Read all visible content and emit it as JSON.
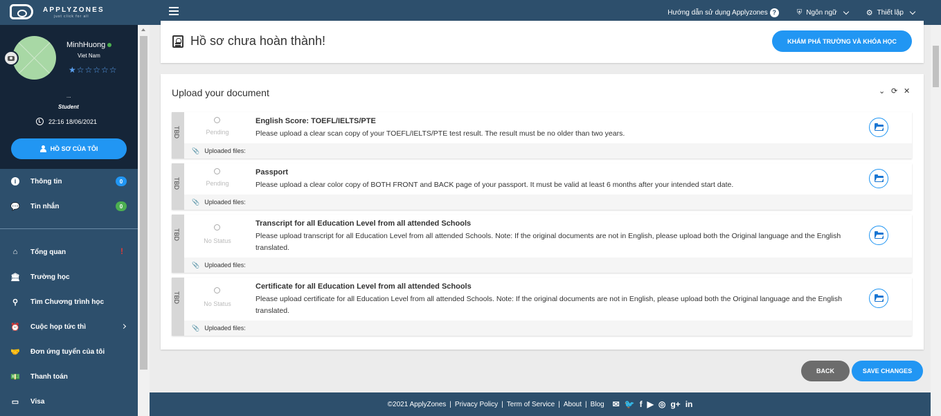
{
  "header": {
    "logo_text": "APPLYZONES",
    "logo_tagline": "just click for all",
    "help_label": "Hướng dẫn sử dụng Applyzones",
    "help_icon": "?",
    "language_label": "Ngôn ngữ",
    "settings_label": "Thiết lập"
  },
  "profile": {
    "name": "MinhHuong",
    "country": "Viet Nam",
    "rating": "★☆☆☆☆☆",
    "placeholder": "...",
    "role": "Student",
    "datetime": "22:16 18/06/2021",
    "button_label": "HỒ SƠ CỦA TÔI"
  },
  "sidebar": {
    "top_items": [
      {
        "label": "Thông tin",
        "badge": "0",
        "badge_color": "#2196f3"
      },
      {
        "label": "Tin nhắn",
        "badge": "0",
        "badge_color": "#4caf50"
      }
    ],
    "items": [
      {
        "label": "Tổng quan",
        "icon": "home-icon",
        "alert": "!"
      },
      {
        "label": "Trường học",
        "icon": "school-icon"
      },
      {
        "label": "Tìm Chương trình học",
        "icon": "search-icon"
      },
      {
        "label": "Cuộc họp tức thì",
        "icon": "meeting-icon"
      },
      {
        "label": "Đơn ứng tuyển của tôi",
        "icon": "handshake-icon"
      },
      {
        "label": "Thanh toán",
        "icon": "money-icon"
      },
      {
        "label": "Visa",
        "icon": "card-icon"
      }
    ]
  },
  "main": {
    "incomplete_title": "Hồ sơ chưa hoàn thành!",
    "explore_button": "KHÁM PHÁ TRƯỜNG VÀ KHÓA HỌC",
    "upload_title": "Upload your document",
    "documents": [
      {
        "tag": "TBD",
        "status": "Pending",
        "title": "English Score: TOEFL/IELTS/PTE",
        "description": "Please upload a clear scan copy of your TOEFL/IELTS/PTE test result. The result must be no older than two years.",
        "uploaded_label": "Uploaded files:"
      },
      {
        "tag": "TBD",
        "status": "Pending",
        "title": "Passport",
        "description": "Please upload a clear color copy of BOTH FRONT and BACK page of your passport. It must be valid at least 6 months after your intended start date.",
        "uploaded_label": "Uploaded files:"
      },
      {
        "tag": "TBD",
        "status": "No Status",
        "title": "Transcript for all Education Level from all attended Schools",
        "description": "Please upload transcript for all Education Level from all attended Schools. Note: If the original documents are not in English, please upload both the Original language and the English translated.",
        "uploaded_label": "Uploaded files:"
      },
      {
        "tag": "TBD",
        "status": "No Status",
        "title": "Certificate for all Education Level from all attended Schools",
        "description": "Please upload certificate for all Education Level from all attended Schools. Note: If the original documents are not in English, please upload both the Original language and the English translated.",
        "uploaded_label": "Uploaded files:"
      }
    ],
    "back_button": "BACK",
    "save_button": "SAVE CHANGES"
  },
  "footer": {
    "copyright": "©2021 ApplyZones",
    "links": [
      "Privacy Policy",
      "Term of Service",
      "About",
      "Blog"
    ],
    "social": [
      "mail-icon",
      "twitter-icon",
      "facebook-icon",
      "youtube-icon",
      "instagram-icon",
      "googleplus-icon",
      "linkedin-icon"
    ]
  }
}
